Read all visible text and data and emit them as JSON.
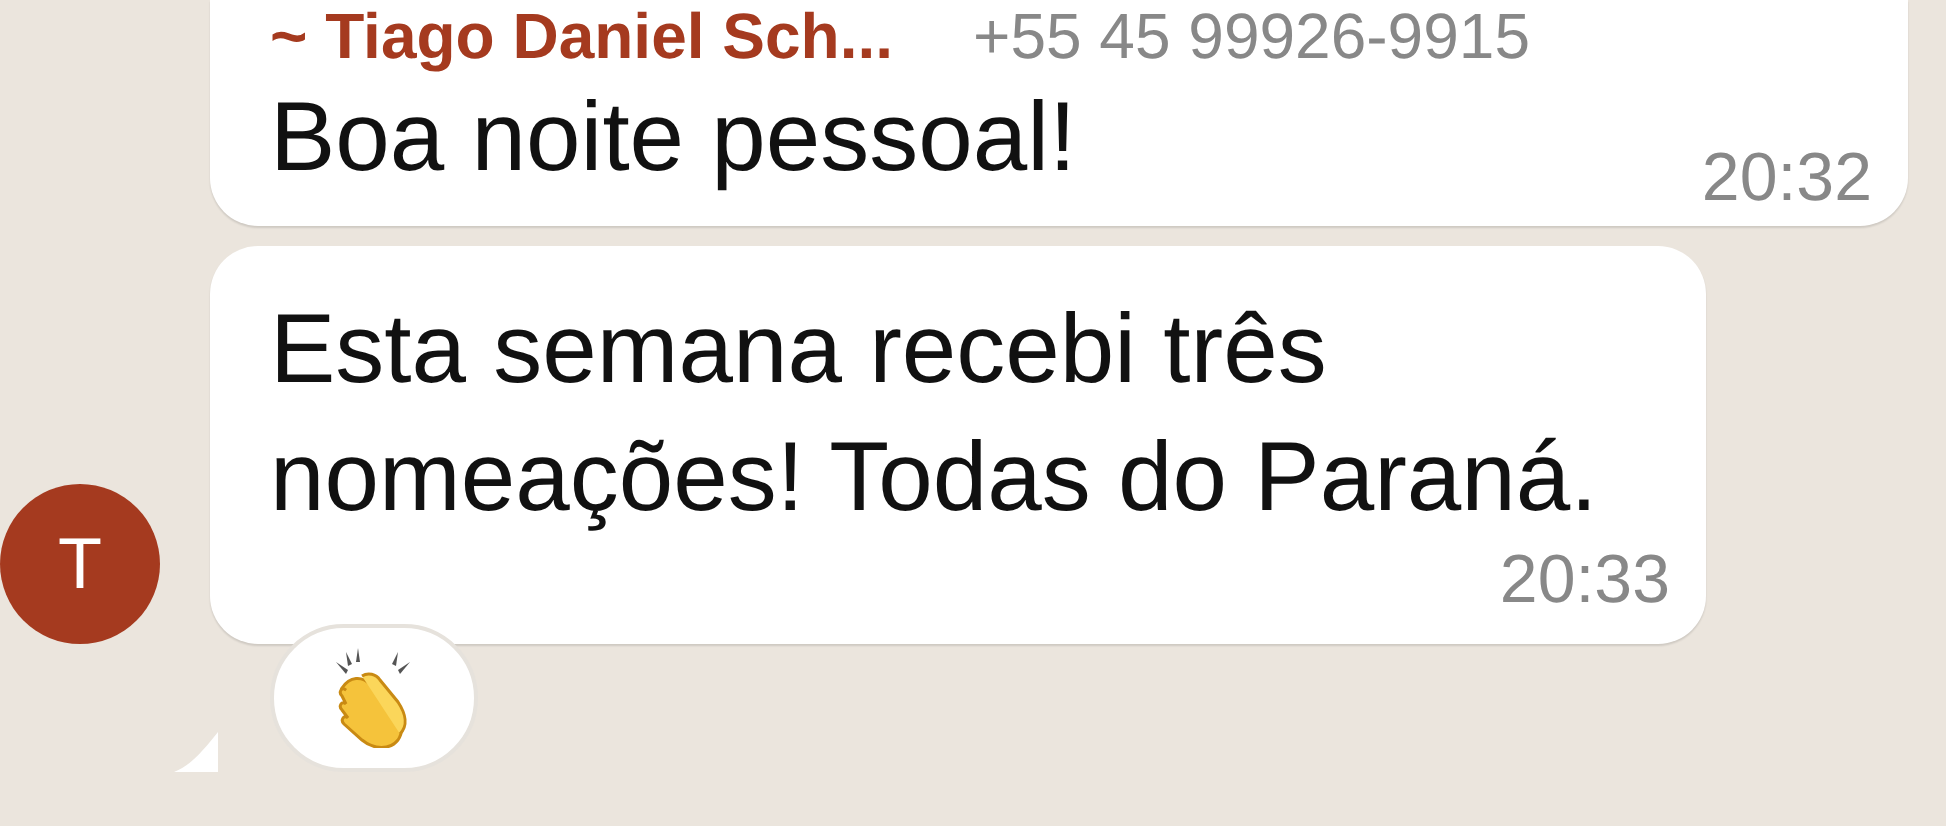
{
  "messages": [
    {
      "sender": "~ Tiago Daniel Sch...",
      "phone": "+55 45 99926-9915",
      "text": "Boa noite pessoal!",
      "time": "20:32"
    },
    {
      "avatar": "T",
      "text": "Esta semana recebi três nomeações! Todas do Paraná.",
      "time": "20:33",
      "reaction": {
        "kind": "clap"
      }
    }
  ]
}
